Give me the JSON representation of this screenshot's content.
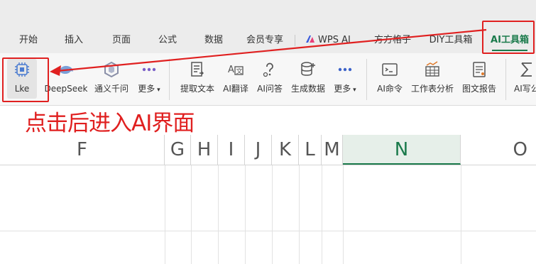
{
  "tabs": [
    {
      "label": "开始"
    },
    {
      "label": "插入"
    },
    {
      "label": "页面"
    },
    {
      "label": "公式"
    },
    {
      "label": "数据"
    },
    {
      "label": "会员专享"
    },
    {
      "label": "WPS AI"
    },
    {
      "label": "方方格子"
    },
    {
      "label": "DIY工具箱"
    },
    {
      "label": "AI工具箱"
    }
  ],
  "active_tab": "AI工具箱",
  "ribbon": {
    "buttons": [
      {
        "label": "Lke",
        "icon": "chip-icon"
      },
      {
        "label": "DeepSeek",
        "icon": "whale-icon"
      },
      {
        "label": "通义千问",
        "icon": "tongyi-icon"
      },
      {
        "label": "更多",
        "icon": "more-dots-icon"
      },
      {
        "label": "提取文本",
        "icon": "extract-text-icon"
      },
      {
        "label": "AI翻译",
        "icon": "translate-icon"
      },
      {
        "label": "AI问答",
        "icon": "qa-icon"
      },
      {
        "label": "生成数据",
        "icon": "database-icon"
      },
      {
        "label": "更多",
        "icon": "more-dots-icon"
      },
      {
        "label": "AI命令",
        "icon": "terminal-icon"
      },
      {
        "label": "工作表分析",
        "icon": "sheet-chart-icon"
      },
      {
        "label": "图文报告",
        "icon": "report-icon"
      },
      {
        "label": "AI写公",
        "icon": "sigma-icon"
      }
    ]
  },
  "annotation": {
    "text": "点击后进入AI界面",
    "color": "#e02020"
  },
  "columns": [
    "F",
    "G",
    "H",
    "I",
    "J",
    "K",
    "L",
    "M",
    "N",
    "O"
  ],
  "selected_column": "N",
  "colors": {
    "accent": "#1a7a4b",
    "annotation_red": "#e02020",
    "wps_ai_blue": "#3b5bdb"
  }
}
